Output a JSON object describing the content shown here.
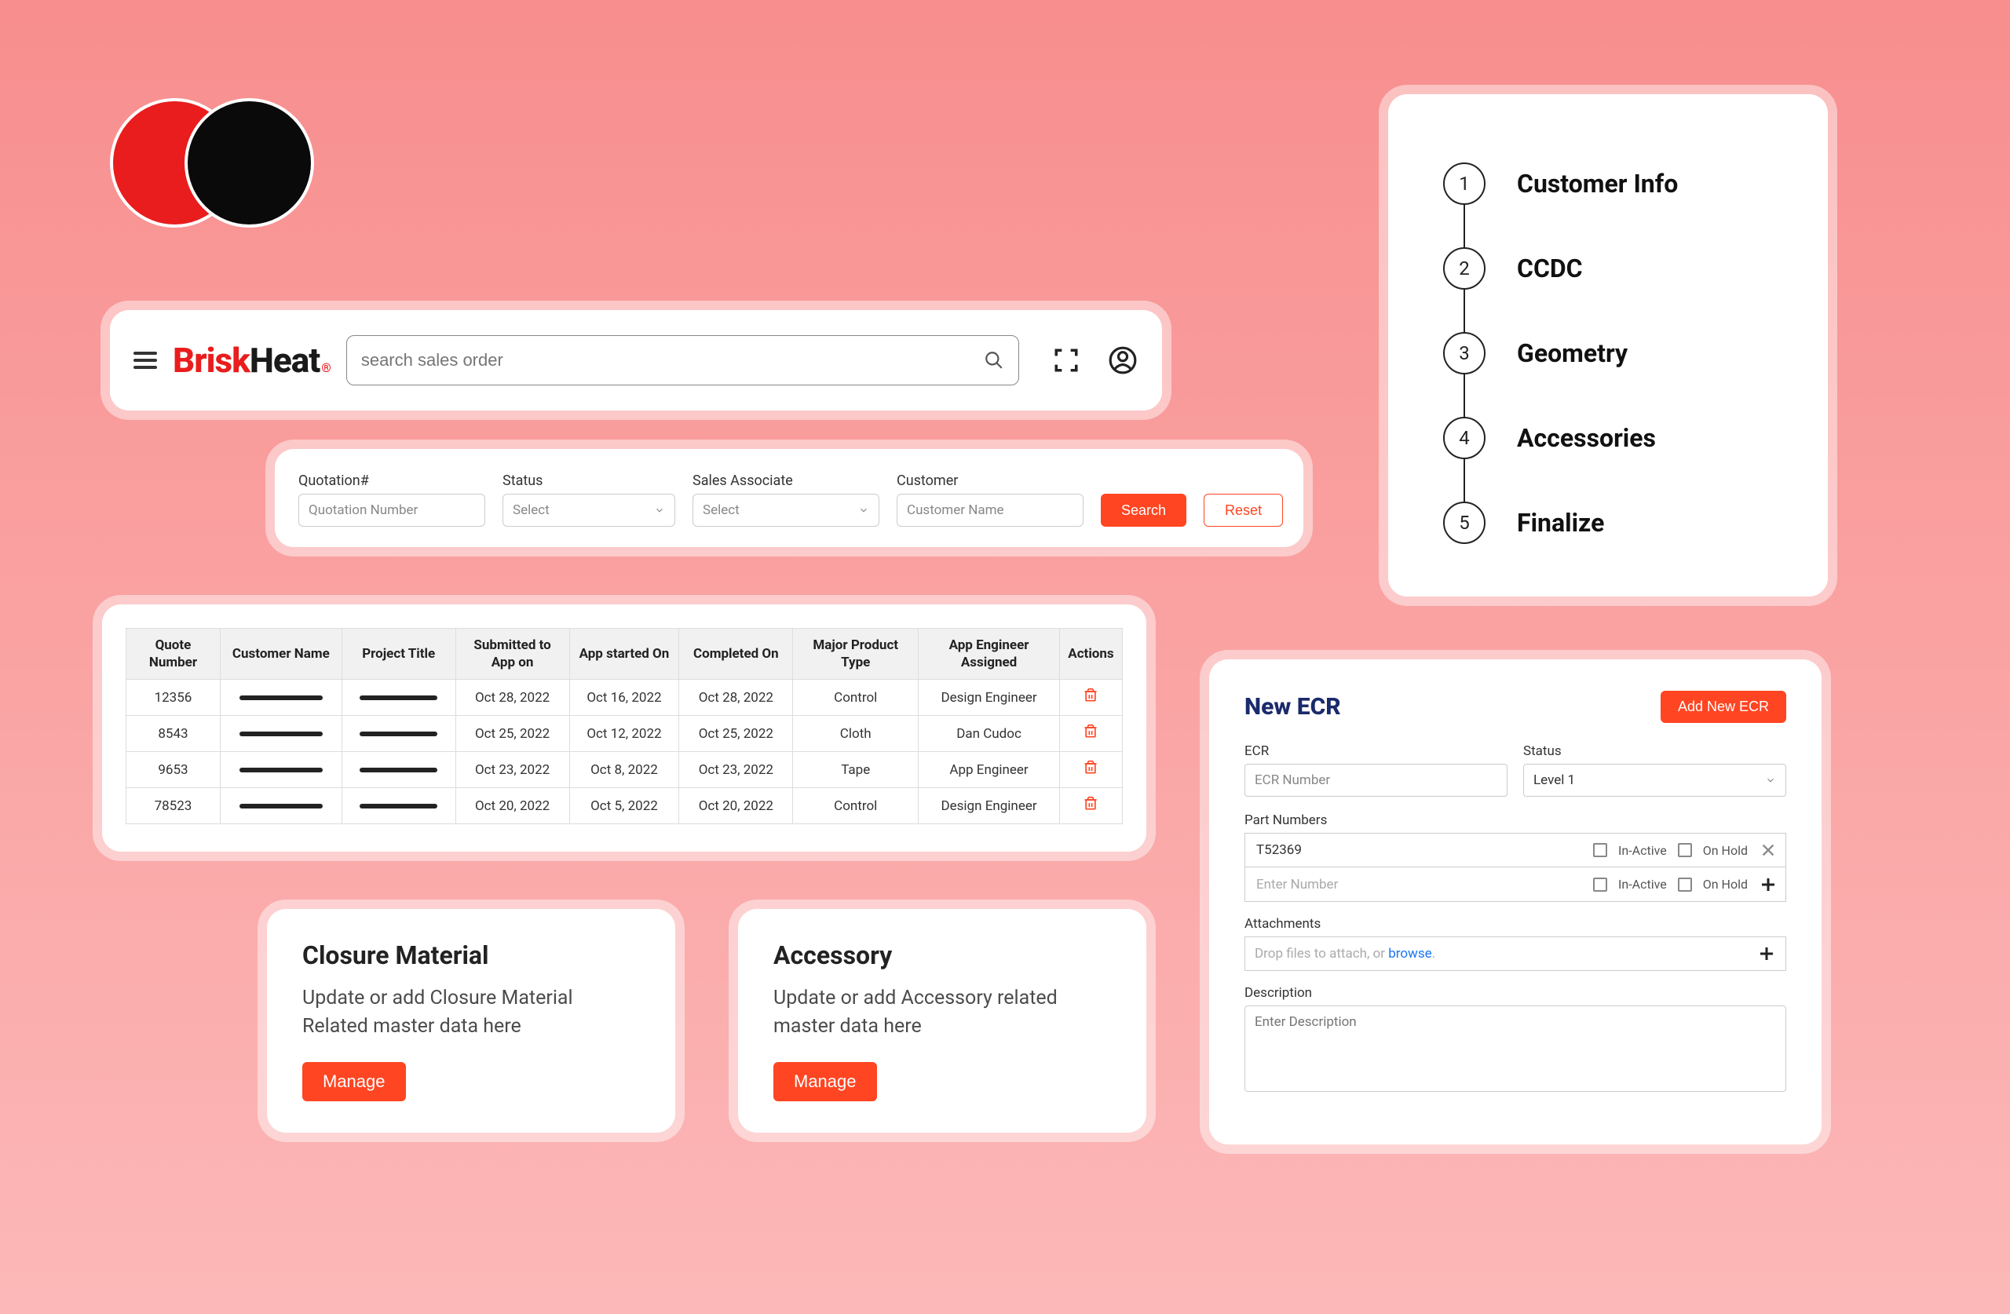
{
  "brand": {
    "part1": "Brisk",
    "part2": "Heat"
  },
  "search": {
    "placeholder": "search sales order"
  },
  "filters": {
    "quotation": {
      "label": "Quotation#",
      "placeholder": "Quotation Number"
    },
    "status": {
      "label": "Status",
      "placeholder": "Select"
    },
    "salesAssociate": {
      "label": "Sales Associate",
      "placeholder": "Select"
    },
    "customer": {
      "label": "Customer",
      "placeholder": "Customer Name"
    },
    "searchBtn": "Search",
    "resetBtn": "Reset"
  },
  "stepper": [
    {
      "num": "1",
      "label": "Customer Info"
    },
    {
      "num": "2",
      "label": "CCDC"
    },
    {
      "num": "3",
      "label": "Geometry"
    },
    {
      "num": "4",
      "label": "Accessories"
    },
    {
      "num": "5",
      "label": "Finalize"
    }
  ],
  "table": {
    "headers": [
      "Quote Number",
      "Customer Name",
      "Project Title",
      "Submitted to App on",
      "App started On",
      "Completed On",
      "Major Product Type",
      "App Engineer Assigned",
      "Actions"
    ],
    "rows": [
      {
        "q": "12356",
        "sub": "Oct 28, 2022",
        "start": "Oct 16, 2022",
        "comp": "Oct 28, 2022",
        "mpt": "Control",
        "eng": "Design Engineer"
      },
      {
        "q": "8543",
        "sub": "Oct 25, 2022",
        "start": "Oct 12, 2022",
        "comp": "Oct 25, 2022",
        "mpt": "Cloth",
        "eng": "Dan Cudoc"
      },
      {
        "q": "9653",
        "sub": "Oct 23, 2022",
        "start": "Oct 8, 2022",
        "comp": "Oct 23, 2022",
        "mpt": "Tape",
        "eng": "App Engineer"
      },
      {
        "q": "78523",
        "sub": "Oct 20, 2022",
        "start": "Oct 5, 2022",
        "comp": "Oct 20, 2022",
        "mpt": "Control",
        "eng": "Design Engineer"
      }
    ]
  },
  "cards": {
    "closure": {
      "title": "Closure Material",
      "text": "Update or add Closure Material Related master data here",
      "btn": "Manage"
    },
    "accessory": {
      "title": "Accessory",
      "text": "Update or add Accessory related master data here",
      "btn": "Manage"
    }
  },
  "ecr": {
    "title": "New ECR",
    "addBtn": "Add New ECR",
    "ecrLabel": "ECR",
    "ecrPlaceholder": "ECR Number",
    "statusLabel": "Status",
    "statusValue": "Level 1",
    "partNumLabel": "Part Numbers",
    "part1": "T52369",
    "part2Placeholder": "Enter Number",
    "inactiveLabel": "In-Active",
    "onholdLabel": "On Hold",
    "attachLabel": "Attachments",
    "attachPlaceholder": "Drop files to attach, or ",
    "attachBrowse": "browse",
    "descLabel": "Description",
    "descPlaceholder": "Enter Description"
  }
}
